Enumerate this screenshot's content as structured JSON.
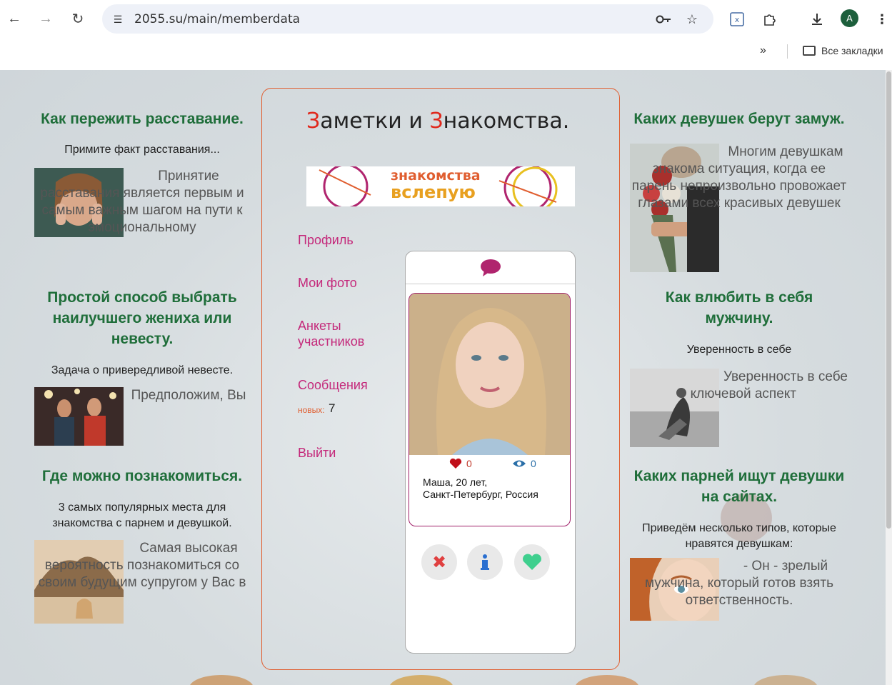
{
  "browser": {
    "url": "2055.su/main/memberdata",
    "avatar_letter": "A",
    "bookmarks_all": "Все закладки",
    "bookmarks_more": "»"
  },
  "site": {
    "title_first_letter_1": "З",
    "title_rest_1": "аметки и ",
    "title_first_letter_2": "З",
    "title_rest_2": "накомства.",
    "banner_text_1": "знакомства",
    "banner_text_2": "вслепую"
  },
  "menu": {
    "profile": "Профиль",
    "photos": "Мои фото",
    "members": "Анкеты участников",
    "messages": "Сообщения",
    "new_label": "новых:",
    "new_count": "7",
    "logout": "Выйти"
  },
  "profile_card": {
    "likes": "0",
    "views": "0",
    "name_age": "Маша, 20 лет,",
    "location": "Санкт-Петербург, Россия"
  },
  "left_articles": [
    {
      "title": "Как пережить расставание.",
      "lead": "Примите факт расставания...",
      "text": "Принятие расставания является первым и самым важным шагом на пути к эмоциональному"
    },
    {
      "title": "Простой способ выбрать наилучшего жениха или невесту.",
      "lead": "Задача о привередливой невесте.",
      "text": "Предположим, Вы"
    },
    {
      "title": "Где можно познакомиться.",
      "lead": "3 самых популярных места для знакомства с парнем и девушкой.",
      "text": "Самая высокая вероятность познакомиться со своим будущим супругом у Вас в"
    }
  ],
  "right_articles": [
    {
      "title": "Каких девушек берут замуж.",
      "lead": "",
      "text": "Многим девушкам знакома ситуация, когда ее парень непроизвольно провожает глазами всех красивых девушек"
    },
    {
      "title": "Как влюбить в себя мужчину.",
      "lead": "Уверенность в себе",
      "text": "Уверенность в себе - ключевой аспект"
    },
    {
      "title": "Каких парней ищут девушки на сайтах.",
      "lead": "Приведём несколько типов, которые нравятся девушкам:",
      "text": "- Он - зрелый мужчина, который готов взять ответственность."
    }
  ],
  "colors": {
    "accent_pink": "#c4287a",
    "title_green": "#1f6e3a",
    "border_orange": "#e05e30",
    "title_red": "#e0281c"
  }
}
